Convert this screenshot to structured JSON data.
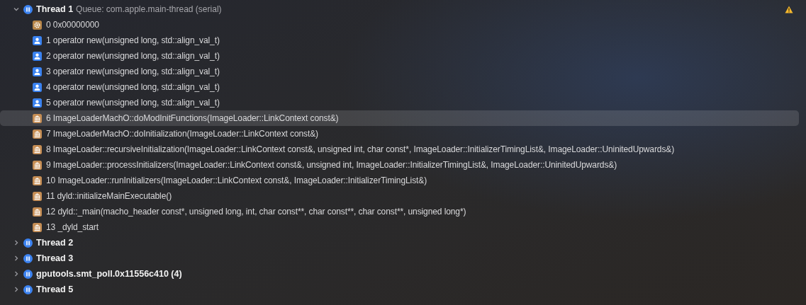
{
  "threads": [
    {
      "name": "Thread 1",
      "queue": "Queue: com.apple.main-thread (serial)",
      "expanded": true,
      "warning": true,
      "frames": [
        {
          "kind": "system",
          "text": "0 0x00000000",
          "selected": false
        },
        {
          "kind": "user",
          "text": "1 operator new(unsigned long, std::align_val_t)",
          "selected": false
        },
        {
          "kind": "user",
          "text": "2 operator new(unsigned long, std::align_val_t)",
          "selected": false
        },
        {
          "kind": "user",
          "text": "3 operator new(unsigned long, std::align_val_t)",
          "selected": false
        },
        {
          "kind": "user",
          "text": "4 operator new(unsigned long, std::align_val_t)",
          "selected": false
        },
        {
          "kind": "user",
          "text": "5 operator new(unsigned long, std::align_val_t)",
          "selected": false
        },
        {
          "kind": "library",
          "text": "6 ImageLoaderMachO::doModInitFunctions(ImageLoader::LinkContext const&)",
          "selected": true
        },
        {
          "kind": "library",
          "text": "7 ImageLoaderMachO::doInitialization(ImageLoader::LinkContext const&)",
          "selected": false
        },
        {
          "kind": "library",
          "text": "8 ImageLoader::recursiveInitialization(ImageLoader::LinkContext const&, unsigned int, char const*, ImageLoader::InitializerTimingList&, ImageLoader::UninitedUpwards&)",
          "selected": false
        },
        {
          "kind": "library",
          "text": "9 ImageLoader::processInitializers(ImageLoader::LinkContext const&, unsigned int, ImageLoader::InitializerTimingList&, ImageLoader::UninitedUpwards&)",
          "selected": false
        },
        {
          "kind": "library",
          "text": "10 ImageLoader::runInitializers(ImageLoader::LinkContext const&, ImageLoader::InitializerTimingList&)",
          "selected": false
        },
        {
          "kind": "library",
          "text": "11 dyld::initializeMainExecutable()",
          "selected": false
        },
        {
          "kind": "library",
          "text": "12 dyld::_main(macho_header const*, unsigned long, int, char const**, char const**, char const**, unsigned long*)",
          "selected": false
        },
        {
          "kind": "library",
          "text": "13 _dyld_start",
          "selected": false
        }
      ]
    },
    {
      "name": "Thread 2",
      "expanded": false,
      "warning": false
    },
    {
      "name": "Thread 3",
      "expanded": false,
      "warning": false
    },
    {
      "name": "gputools.smt_poll.0x11556c410 (4)",
      "expanded": false,
      "warning": false
    },
    {
      "name": "Thread 5",
      "expanded": false,
      "warning": false
    }
  ]
}
